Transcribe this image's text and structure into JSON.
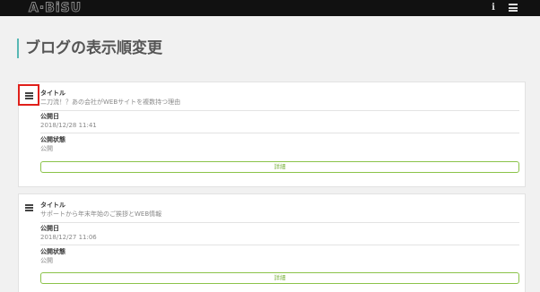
{
  "app": {
    "logo": "A·BiSU"
  },
  "header": {
    "info_icon": "info-icon",
    "menu_icon": "hamburger-menu-icon"
  },
  "page": {
    "title": "ブログの表示順変更"
  },
  "labels": {
    "title": "タイトル",
    "published_date": "公開日",
    "published_status": "公開状態",
    "detail_button": "詳細"
  },
  "posts": [
    {
      "title": "二刀流！？あの会社がWEBサイトを複数持つ理由",
      "published_date": "2018/12/28 11:41",
      "status": "公開"
    },
    {
      "title": "サポートから年末年始のご挨拶とWEB情報",
      "published_date": "2018/12/27 11:06",
      "status": "公開"
    }
  ],
  "colors": {
    "accent": "#58b8b4",
    "button_border": "#8bc34a",
    "highlight": "#e0201b",
    "topbar": "#111111"
  }
}
